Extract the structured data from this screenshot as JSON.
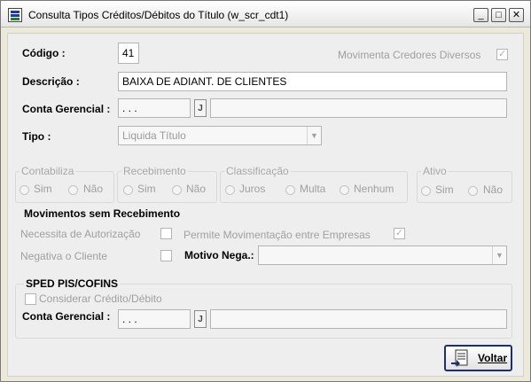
{
  "window": {
    "title": "Consulta Tipos Créditos/Débitos do Título (w_scr_cdt1)",
    "minimize_glyph": "_",
    "maximize_glyph": "□",
    "close_glyph": "✕"
  },
  "form": {
    "codigo_label": "Código :",
    "codigo_value": "41",
    "movimenta_label": "Movimenta Credores Diversos",
    "movimenta_checked": true,
    "descricao_label": "Descrição :",
    "descricao_value": "BAIXA DE ADIANT. DE CLIENTES",
    "conta_label": "Conta Gerencial :",
    "conta_value": ". . .",
    "conta_desc": "",
    "tipo_label": "Tipo :",
    "tipo_value": "Liquida Título"
  },
  "groups": {
    "contabiliza": {
      "title": "Contabiliza",
      "opt1": "Sim",
      "opt2": "Não"
    },
    "recebimento": {
      "title": "Recebimento",
      "opt1": "Sim",
      "opt2": "Não"
    },
    "classificacao": {
      "title": "Classificação",
      "opt1": "Juros",
      "opt2": "Multa",
      "opt3": "Nenhum"
    },
    "ativo": {
      "title": "Ativo",
      "opt1": "Sim",
      "opt2": "Não"
    }
  },
  "movimentos": {
    "title": "Movimentos sem Recebimento",
    "necessita_label": "Necessita de Autorização",
    "permite_label": "Permite Movimentação entre Empresas",
    "permite_checked": true,
    "negativa_label": "Negativa o Cliente",
    "motivo_label": "Motivo Nega.:",
    "motivo_value": ""
  },
  "sped": {
    "title": "SPED PIS/COFINS",
    "considerar_label": "Considerar Crédito/Débito",
    "conta_label": "Conta Gerencial :",
    "conta_value": ". . .",
    "conta_desc": ""
  },
  "buttons": {
    "voltar_label": "Voltar"
  },
  "icons": {
    "lookup_glyph": "J",
    "check_glyph": "✓",
    "dropdown_glyph": "▼"
  },
  "colors": {
    "window_bg": "#ece9d8",
    "panel_bg": "#eeeeee",
    "disabled_text": "#a0a0a0",
    "button_border": "#1e2f6e"
  }
}
